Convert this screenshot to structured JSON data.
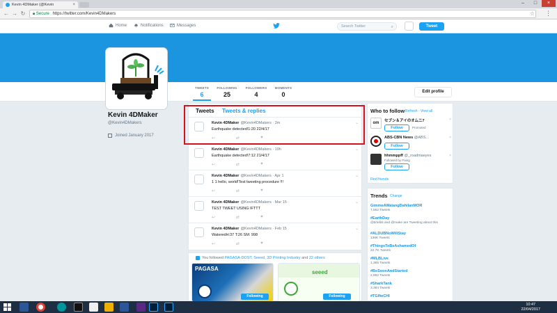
{
  "browser": {
    "tab_title": "Kevin 4DMaker (@Kevin",
    "tab_close": "×",
    "win_min": "–",
    "win_max": "□",
    "win_close": "×",
    "secure_label": "Secure",
    "url": "https://twitter.com/Kevin4DMakers",
    "back_icon": "arrow-left",
    "forward_icon": "arrow-right",
    "reload_icon": "reload"
  },
  "twitter_nav": {
    "home": "Home",
    "notifications": "Notifications",
    "messages": "Messages",
    "search_placeholder": "Search Twitter",
    "tweet_button": "Tweet"
  },
  "profile": {
    "name": "Kevin 4DMaker",
    "handle": "@Kevin4DMakers",
    "joined": "Joined January 2017",
    "edit_profile": "Edit profile",
    "stats": [
      {
        "label": "TWEETS",
        "value": "6"
      },
      {
        "label": "FOLLOWING",
        "value": "25"
      },
      {
        "label": "FOLLOWERS",
        "value": "4"
      },
      {
        "label": "MOMENTS",
        "value": "0"
      }
    ]
  },
  "timeline": {
    "tab_tweets": "Tweets",
    "tab_replies": "Tweets & replies",
    "tweets": [
      {
        "name": "Kevin 4DMaker",
        "meta": "@Kevin4DMakers · 2m",
        "text": "Earthquake detected!1:20 22/4/17"
      },
      {
        "name": "Kevin 4DMaker",
        "meta": "@Kevin4DMakers · 19h",
        "text": "Earthquake detected!7:12 21/4/17"
      },
      {
        "name": "Kevin 4DMaker",
        "meta": "@Kevin4DMakers · Apr 1",
        "text": "1 1 hello, world!Test tweeting procedure !!!"
      },
      {
        "name": "Kevin 4DMaker",
        "meta": "@Kevin4DMakers · Mar 15",
        "text": "TEST TWEET USING IFTTT"
      },
      {
        "name": "Kevin 4DMaker",
        "meta": "@Kevin4DMakers · Feb 15",
        "text": "WateredH:37 T:26 SM: 998"
      }
    ]
  },
  "followed": {
    "prefix": "You followed",
    "accounts": "PAGASA-DOST, Seeed, 3D Printing Industry",
    "suffix": "and",
    "others": "22 others",
    "cards": [
      {
        "label": "PAGASA",
        "button": "Following"
      },
      {
        "label": "seeed",
        "button": "Following"
      }
    ]
  },
  "who_to_follow": {
    "title": "Who to follow",
    "refresh": "Refresh",
    "view_all": "View all",
    "items": [
      {
        "name": "セブン＆アイのオムニ7",
        "handle": "",
        "sub": "",
        "button": "Follow",
        "extra": "Promoted"
      },
      {
        "name": "ABS-CBN News",
        "handle": "@ABS...",
        "sub": "",
        "button": "Follow",
        "extra": ""
      },
      {
        "name": "hhmmppff",
        "handle": "@_roadmaeyes",
        "sub": "Followed by Paing",
        "button": "Follow",
        "extra": ""
      }
    ],
    "find_friends": "Find friends"
  },
  "trends": {
    "title": "Trends",
    "change": "Change",
    "items": [
      {
        "name": "GimmeAWalangDahilanMOR",
        "count": "7,562 Tweets"
      },
      {
        "name": "#EarthDay",
        "count": "@tirtelits and @make are Tweeting about this"
      },
      {
        "name": "#ALDUBNoWillStay",
        "count": "136K Tweets"
      },
      {
        "name": "#ThingsToBeAshamedOf",
        "count": "22.7K Tweets"
      },
      {
        "name": "#MLBLive",
        "count": "1,365 Tweets"
      },
      {
        "name": "#BeSoonAndStarted",
        "count": "2,892 Tweets"
      },
      {
        "name": "#SharkTank",
        "count": "3,384 Tweets"
      },
      {
        "name": "#TGIfwCHI",
        "count": ""
      }
    ]
  },
  "taskbar": {
    "time": "10:47",
    "date": "22/04/2017"
  },
  "colors": {
    "twitter_blue": "#1da1f2",
    "banner": "#1b95e0",
    "highlight_red": "#d8101e"
  }
}
